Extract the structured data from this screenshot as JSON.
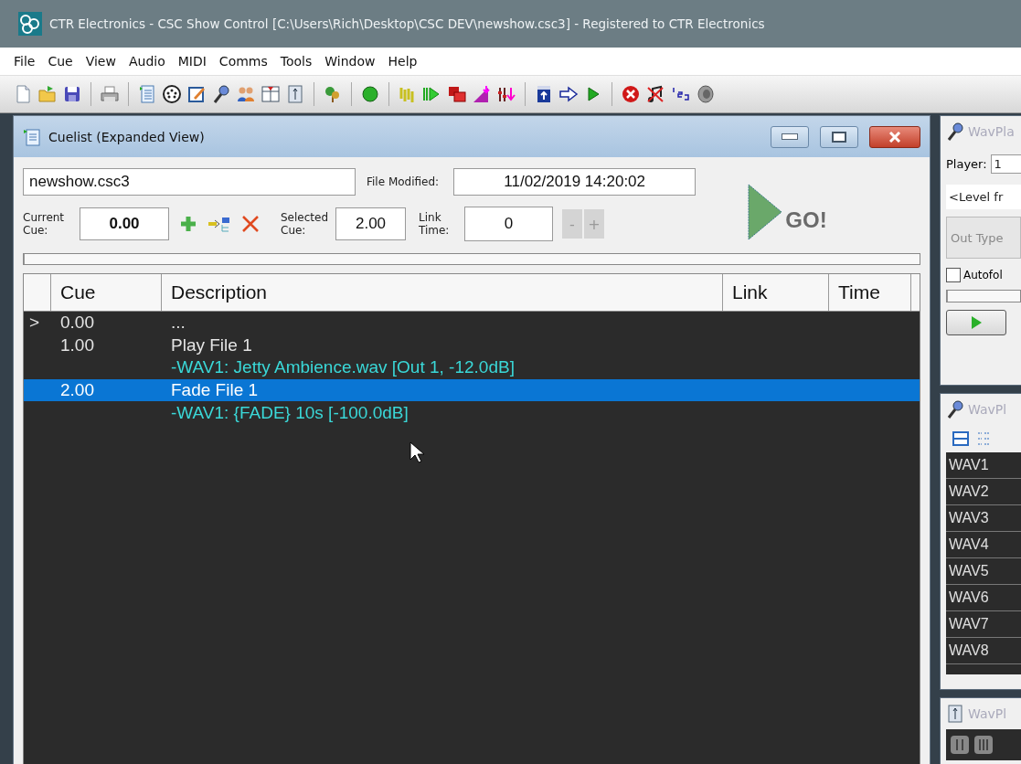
{
  "window": {
    "title": "CTR Electronics - CSC Show Control [C:\\Users\\Rich\\Desktop\\CSC DEV\\newshow.csc3] - Registered to CTR Electronics"
  },
  "menu": [
    "File",
    "Cue",
    "View",
    "Audio",
    "MIDI",
    "Comms",
    "Tools",
    "Window",
    "Help"
  ],
  "cuelist": {
    "title": "Cuelist (Expanded View)",
    "file_name": "newshow.csc3",
    "file_modified_label": "File Modified:",
    "file_modified": "11/02/2019 14:20:02",
    "current_cue_label": "Current Cue:",
    "current_cue": "0.00",
    "selected_cue_label": "Selected Cue:",
    "selected_cue": "2.00",
    "link_time_label": "Link Time:",
    "link_time": "0",
    "minus": "-",
    "plus": "+",
    "go": "GO!",
    "progress": {
      "level": 0
    },
    "columns": [
      "Cue",
      "Description",
      "Link",
      "Time"
    ],
    "rows": [
      {
        "kind": "cue",
        "marker": ">",
        "cue": "0.00",
        "description": "...",
        "selected": false
      },
      {
        "kind": "cue",
        "cue": "1.00",
        "description": "Play File 1",
        "selected": false
      },
      {
        "kind": "detail",
        "description": "-WAV1: Jetty Ambience.wav [Out 1, -12.0dB]"
      },
      {
        "kind": "cue",
        "cue": "2.00",
        "description": "Fade File 1",
        "selected": true
      },
      {
        "kind": "detail",
        "description": "-WAV1: {FADE} 10s [-100.0dB]"
      }
    ]
  },
  "player_panel": {
    "title": "WavPla",
    "player_label": "Player:",
    "player": "1",
    "level_field": "<Level fr",
    "out_type": "Out Type",
    "autofollow": {
      "label": "Autofol",
      "checked": false
    },
    "progress": {
      "level": 0
    }
  },
  "list_panel": {
    "title": "WavPl",
    "items": [
      "WAV1",
      "WAV2",
      "WAV3",
      "WAV4",
      "WAV5",
      "WAV6",
      "WAV7",
      "WAV8"
    ]
  },
  "third_panel": {
    "title": "WavPl"
  }
}
